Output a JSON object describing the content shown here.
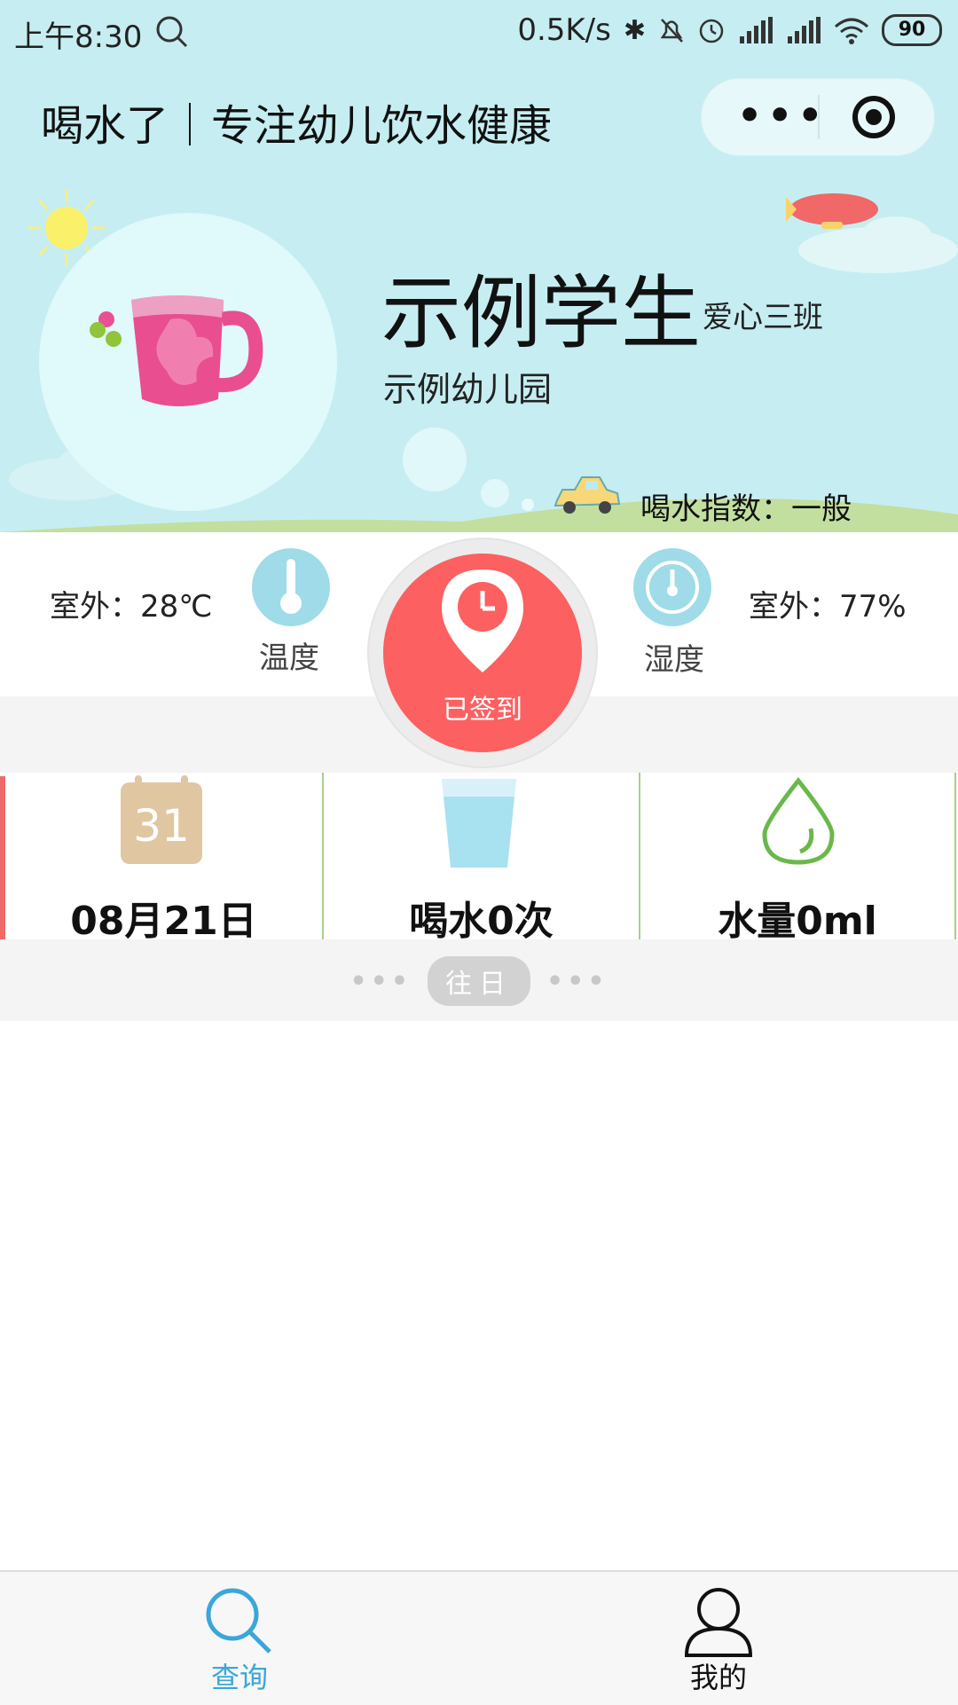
{
  "status_bar": {
    "time": "上午8:30",
    "network_speed": "0.5K/s",
    "battery": "90",
    "icons": [
      "search-icon",
      "bluetooth-icon",
      "mute-icon",
      "alarm-icon",
      "signal-icon",
      "signal-icon",
      "wifi-icon",
      "battery-icon"
    ]
  },
  "nav": {
    "title": "喝水了｜专注幼儿饮水健康",
    "menu_label": "•••",
    "icons": [
      "more-icon",
      "target-icon"
    ]
  },
  "student": {
    "name": "示例学生",
    "class": "爱心三班",
    "school": "示例幼儿园",
    "drink_index": "喝水指数：一般"
  },
  "weather": {
    "outdoor_temp": "室外：28℃",
    "temp_label": "温度",
    "outdoor_humidity": "室外：77%",
    "humidity_label": "湿度"
  },
  "checkin": {
    "label": "已签到"
  },
  "cards": {
    "calendar_day": "31",
    "date": "08月21日",
    "drink_count": "喝水0次",
    "water_amount": "水量0ml"
  },
  "pager": {
    "dots_left": "•••",
    "label": "往日",
    "dots_right": "•••"
  },
  "tabbar": {
    "query": "查询",
    "mine": "我的"
  },
  "colors": {
    "hero_bg": "#c6eef2",
    "checkin_red": "#fc6060",
    "tab_active": "#3aa6d9",
    "card_divider": "#a8d08d",
    "card_left_accent": "#f06a6a"
  }
}
